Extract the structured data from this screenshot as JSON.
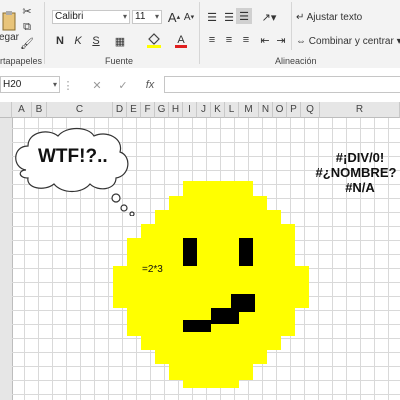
{
  "ribbon": {
    "paste_label": "egar",
    "clipboard_group": "rtapapeles",
    "font_group": "Fuente",
    "alignment_group": "Alineación",
    "font_name": "Calibri",
    "font_size": "11",
    "bold": "N",
    "italic": "K",
    "underline": "S",
    "wrap_text": "Ajustar texto",
    "merge_center": "Combinar y centrar",
    "grow_font": "A",
    "shrink_font": "A"
  },
  "formula_bar": {
    "name_box": "H20",
    "fx": "fx",
    "formula": ""
  },
  "columns": [
    "A",
    "B",
    "C",
    "D",
    "E",
    "F",
    "G",
    "H",
    "I",
    "J",
    "K",
    "L",
    "M",
    "N",
    "O",
    "P",
    "Q",
    "R"
  ],
  "sheet": {
    "thought_text": "WTF!?..",
    "formula_cell": "=2*3",
    "errors": [
      "#¡DIV/0!",
      "#¿NOMBRE?",
      "#N/A"
    ]
  },
  "colors": {
    "smiley_fill": "#ffff00",
    "smiley_features": "#000000",
    "ribbon_bg": "#f3f3f3",
    "grid_line": "#d9d9d9"
  }
}
